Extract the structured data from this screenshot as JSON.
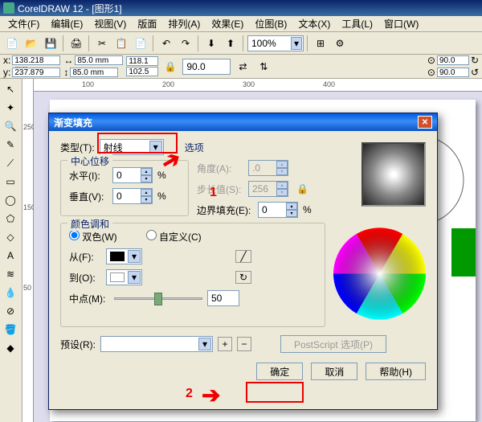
{
  "app": {
    "title": "CorelDRAW 12 - [图形1]"
  },
  "menu": {
    "items": [
      "文件(F)",
      "编辑(E)",
      "视图(V)",
      "版面",
      "排列(A)",
      "效果(E)",
      "位图(B)",
      "文本(X)",
      "工具(L)",
      "窗口(W)"
    ]
  },
  "zoom": "100%",
  "coords": {
    "x_label": "x:",
    "x": "138.218 mm",
    "y_label": "y:",
    "y": "237.879 mm",
    "w": "85.0 mm",
    "h": "85.0 mm",
    "p1": "118.1",
    "p2": "102.5",
    "r1": "90.0",
    "r2": "90.0"
  },
  "ruler": {
    "h": [
      "100",
      "200",
      "300",
      "400"
    ],
    "v": [
      "250",
      "150",
      "50"
    ]
  },
  "dialog": {
    "title": "渐变填充",
    "type": {
      "label": "类型(T):",
      "value": "射线"
    },
    "options_label": "选项",
    "center": {
      "title": "中心位移",
      "h_label": "水平(I):",
      "h_val": "0",
      "v_label": "垂直(V):",
      "v_val": "0",
      "pct": "%"
    },
    "angle": {
      "label": "角度(A):",
      "val": ".0"
    },
    "steps": {
      "label": "步长值(S):",
      "val": "256"
    },
    "edge": {
      "label": "边界填充(E):",
      "val": "0",
      "pct": "%"
    },
    "blend": {
      "title": "颜色调和",
      "two": "双色(W)",
      "custom": "自定义(C)",
      "from": "从(F):",
      "to": "到(O):",
      "mid": "中点(M):",
      "mid_val": "50"
    },
    "preset": {
      "label": "预设(R):",
      "ps": "PostScript 选项(P)"
    },
    "buttons": {
      "ok": "确定",
      "cancel": "取消",
      "help": "帮助(H)"
    },
    "annot": {
      "one": "1",
      "two": "2"
    }
  }
}
